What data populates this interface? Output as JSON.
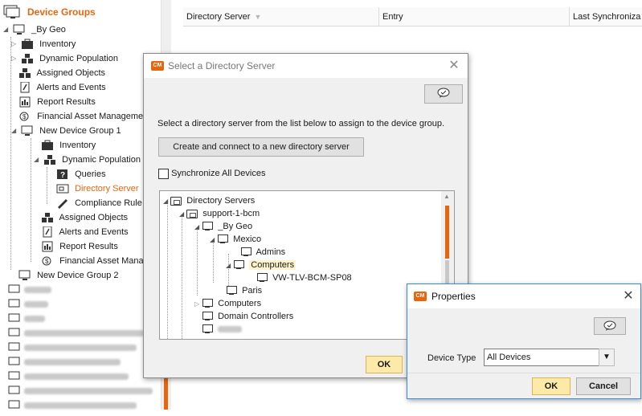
{
  "left_tree": {
    "title": "Device Groups",
    "items": [
      {
        "label": "_By Geo"
      },
      {
        "label": "Inventory"
      },
      {
        "label": "Dynamic Population"
      },
      {
        "label": "Assigned Objects"
      },
      {
        "label": "Alerts and Events"
      },
      {
        "label": "Report Results"
      },
      {
        "label": "Financial Asset Manageme"
      },
      {
        "label": "New Device Group 1"
      },
      {
        "label": "Inventory"
      },
      {
        "label": "Dynamic Population"
      },
      {
        "label": "Queries"
      },
      {
        "label": "Directory Server"
      },
      {
        "label": "Compliance Rule"
      },
      {
        "label": "Assigned Objects"
      },
      {
        "label": "Alerts and Events"
      },
      {
        "label": "Report Results"
      },
      {
        "label": "Financial Asset Manag"
      },
      {
        "label": "New Device Group 2"
      }
    ]
  },
  "grid": {
    "columns": [
      "Directory Server",
      "Entry",
      "Last Synchroniza"
    ]
  },
  "select_dialog": {
    "title": "Select a Directory Server",
    "instruction": "Select a directory server from the list below to assign to the device group.",
    "create_button": "Create and connect to a new directory server",
    "sync_label": "Synchronize All Devices",
    "ok": "OK",
    "tree": [
      {
        "label": "Directory Servers"
      },
      {
        "label": "support-1-bcm"
      },
      {
        "label": "_By Geo"
      },
      {
        "label": "Mexico"
      },
      {
        "label": "Admins"
      },
      {
        "label": "Computers"
      },
      {
        "label": "VW-TLV-BCM-SP08"
      },
      {
        "label": "Paris"
      },
      {
        "label": "Computers"
      },
      {
        "label": "Domain Controllers"
      }
    ]
  },
  "properties_dialog": {
    "title": "Properties",
    "field_label": "Device Type",
    "field_value": "All Devices",
    "ok": "OK",
    "cancel": "Cancel"
  },
  "colors": {
    "accent": "#e8650d",
    "ok_button": "#fde9a8",
    "selection": "#fdf3cf"
  }
}
